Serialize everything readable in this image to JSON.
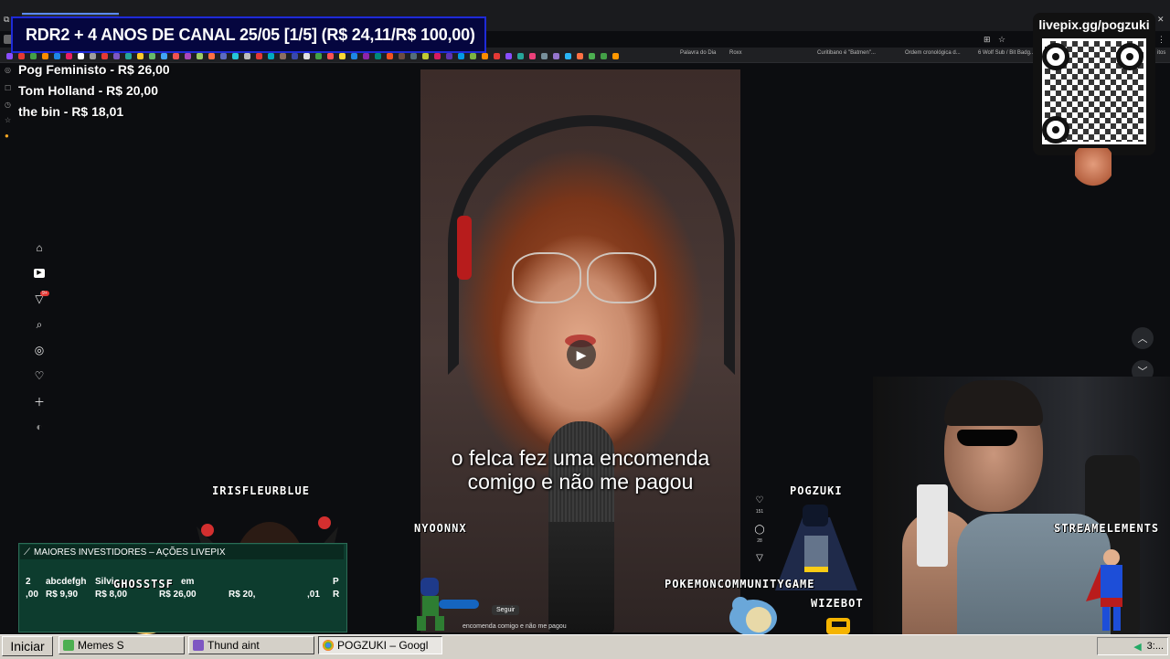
{
  "goal": {
    "text": "RDR2 + 4 ANOS DE CANAL 25/05 [1/5] (R$ 24,11/R$ 100,00)"
  },
  "donors": [
    {
      "label": "Pog Feministo - R$ 26,00"
    },
    {
      "label": "Tom Holland - R$ 20,00"
    },
    {
      "label": "the bin - R$ 18,01"
    }
  ],
  "bookmarks": {
    "palavra": "Palavra do Dia",
    "roxx": "Roxx",
    "curitibano": "Curitibano é \"Batmen\"...",
    "ordem": "Ordem cronológica d...",
    "wolf": "6 Wolf Sub / Bit Badg...",
    "itos": "itos"
  },
  "notif_badge": "9+",
  "video": {
    "caption": "o felca fez uma encomenda comigo e não me pagou",
    "subtitle": "encomenda comigo e não me pagou",
    "follow_label": "Seguir",
    "likes": "151",
    "comments": "28"
  },
  "qr": {
    "title": "livepix.gg/pogzuki"
  },
  "tags": {
    "iris": "IRISFLEURBLUE",
    "nyoon": "NYOONNX",
    "ghost": "GHOSSTSF",
    "pogzuki": "POGZUKI",
    "pokemon": "POKEMONCOMMUNITYGAME",
    "wizebot": "WIZEBOT",
    "streamelements": "STREAMELEMENTS"
  },
  "investors": {
    "title": "MAIORES INVESTIDORES – AÇÕES LIVEPIX",
    "rows": [
      {
        "name": "2",
        "value": ",00"
      },
      {
        "name": "abcdefgh",
        "value": "R$ 9,90"
      },
      {
        "name": "Silvi",
        "value": "R$ 8,00"
      },
      {
        "name": "em",
        "value": "R$ 26,00"
      },
      {
        "name": "",
        "value": "R$ 20,"
      },
      {
        "name": "",
        "value": ",01"
      },
      {
        "name": "P",
        "value": "R"
      }
    ]
  },
  "taskbar": {
    "start": "Iniciar",
    "tasks": [
      {
        "label": "Memes S"
      },
      {
        "label": "Thund        aint"
      },
      {
        "label": "POGZUKI – Googl"
      }
    ],
    "clock": "3:..."
  },
  "colors": {
    "goal_bg": "#05063f",
    "goal_border": "#1e2ad8",
    "investors_bg": "#0d3c2e",
    "taskbar": "#d4d0c8"
  }
}
